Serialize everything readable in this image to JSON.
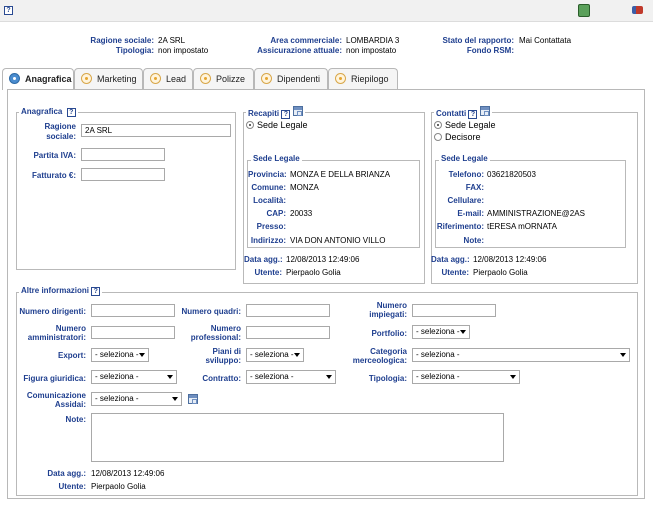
{
  "topbar": {
    "help": "?"
  },
  "header": {
    "ragione_sociale_label": "Ragione sociale:",
    "ragione_sociale_value": "2A SRL",
    "tipologia_label": "Tipologia:",
    "tipologia_value": "non impostato",
    "area_label": "Area commerciale:",
    "area_value": "LOMBARDIA 3",
    "assicurazione_label": "Assicurazione attuale:",
    "assicurazione_value": "non impostato",
    "stato_label": "Stato del rapporto:",
    "stato_value": "Mai Contattata",
    "fondo_label": "Fondo RSM:"
  },
  "tabs": [
    {
      "label": "Anagrafica"
    },
    {
      "label": "Marketing"
    },
    {
      "label": "Lead"
    },
    {
      "label": "Polizze"
    },
    {
      "label": "Dipendenti"
    },
    {
      "label": "Riepilogo"
    }
  ],
  "anagrafica": {
    "legend": "Anagrafica",
    "ragione_label_1": "Ragione",
    "ragione_label_2": "sociale:",
    "ragione_value": "2A SRL",
    "piva_label": "Partita IVA:",
    "piva_value": "",
    "fatturato_label": "Fatturato €:",
    "fatturato_value": ""
  },
  "recapiti": {
    "legend": "Recapiti",
    "radio_sede": "Sede Legale",
    "sub_legend": "Sede Legale",
    "provincia_label": "Provincia:",
    "provincia_value": "MONZA E DELLA BRIANZA",
    "comune_label": "Comune:",
    "comune_value": "MONZA",
    "localita_label": "Località:",
    "localita_value": "",
    "cap_label": "CAP:",
    "cap_value": "20033",
    "presso_label": "Presso:",
    "presso_value": "",
    "indirizzo_label": "Indirizzo:",
    "indirizzo_value": "VIA DON ANTONIO VILLO",
    "data_label": "Data agg.:",
    "data_value": "12/08/2013 12:49:06",
    "utente_label": "Utente:",
    "utente_value": "Pierpaolo Golia"
  },
  "contatti": {
    "legend": "Contatti",
    "radio_sede": "Sede Legale",
    "radio_decisore": "Decisore",
    "sub_legend": "Sede Legale",
    "telefono_label": "Telefono:",
    "telefono_value": "03621820503",
    "fax_label": "FAX:",
    "fax_value": "",
    "cellulare_label": "Cellulare:",
    "cellulare_value": "",
    "email_label": "E-mail:",
    "email_value": "AMMINISTRAZIONE@2AS",
    "riferimento_label": "Riferimento:",
    "riferimento_value": "tERESA mORNATA",
    "note_label": "Note:",
    "note_value": "",
    "data_label": "Data agg.:",
    "data_value": "12/08/2013 12:49:06",
    "utente_label": "Utente:",
    "utente_value": "Pierpaolo Golia"
  },
  "altre": {
    "legend": "Altre informazioni",
    "dirigenti_label": "Numero dirigenti:",
    "quadri_label": "Numero quadri:",
    "impiegati_label_1": "Numero",
    "impiegati_label_2": "impiegati:",
    "amministratori_label_1": "Numero",
    "amministratori_label_2": "amministratori:",
    "professional_label_1": "Numero",
    "professional_label_2": "professional:",
    "portfolio_label": "Portfolio:",
    "portfolio_value": "- seleziona -",
    "export_label": "Export:",
    "export_value": "- seleziona -",
    "piani_label_1": "Piani di",
    "piani_label_2": "sviluppo:",
    "piani_value": "- seleziona -",
    "categoria_label_1": "Categoria",
    "categoria_label_2": "merceologica:",
    "categoria_value": "- seleziona -",
    "figura_label": "Figura giuridica:",
    "figura_value": "- seleziona -",
    "contratto_label": "Contratto:",
    "contratto_value": "- seleziona -",
    "tipologia_label": "Tipologia:",
    "tipologia_value": "- seleziona -",
    "comunicazione_label_1": "Comunicazione",
    "comunicazione_label_2": "Assidai:",
    "comunicazione_value": "- seleziona -",
    "note_label": "Note:",
    "data_label": "Data agg.:",
    "data_value": "12/08/2013 12:49:06",
    "utente_label": "Utente:",
    "utente_value": "Pierpaolo Golia"
  }
}
